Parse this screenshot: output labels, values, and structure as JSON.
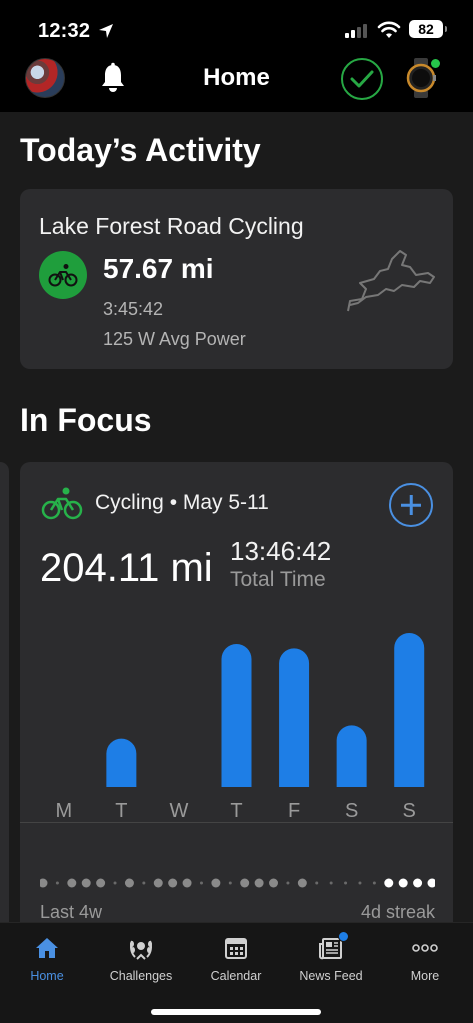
{
  "status_bar": {
    "time": "12:32",
    "battery": "82"
  },
  "header": {
    "title": "Home"
  },
  "today": {
    "section_title": "Today’s Activity",
    "activity_name": "Lake Forest Road Cycling",
    "distance": "57.67 mi",
    "duration": "3:45:42",
    "avg_power": "125 W Avg Power",
    "icon": "cycling-icon"
  },
  "focus": {
    "section_title": "In Focus",
    "label": "Cycling • May 5-11",
    "distance": "204.11 mi",
    "total_time": "13:46:42",
    "total_time_label": "Total Time",
    "streak_left": "Last 4w",
    "streak_right": "4d streak",
    "chart_data": {
      "type": "bar",
      "categories": [
        "M",
        "T",
        "W",
        "T",
        "F",
        "S",
        "S"
      ],
      "values": [
        0,
        22,
        0,
        65,
        63,
        28,
        70
      ],
      "title": "",
      "xlabel": "",
      "ylabel": "",
      "ylim": [
        0,
        75
      ],
      "grid": false,
      "color": "#1e7ee6"
    },
    "streak": {
      "total_days": 28,
      "active_days": [
        0,
        2,
        3,
        4,
        6,
        8,
        9,
        10,
        12,
        14,
        15,
        16,
        18,
        24,
        25,
        26,
        27
      ],
      "highlight_last": 4
    }
  },
  "tabs": [
    {
      "label": "Home",
      "icon": "home-icon",
      "active": true
    },
    {
      "label": "Challenges",
      "icon": "laurel-icon",
      "active": false
    },
    {
      "label": "Calendar",
      "icon": "calendar-icon",
      "active": false
    },
    {
      "label": "News Feed",
      "icon": "newspaper-icon",
      "active": false,
      "badge": true
    },
    {
      "label": "More",
      "icon": "more-icon",
      "active": false
    }
  ],
  "colors": {
    "accent": "#4a90e2",
    "success": "#27a844",
    "bar": "#1e7ee6",
    "card": "#2c2c2e"
  }
}
